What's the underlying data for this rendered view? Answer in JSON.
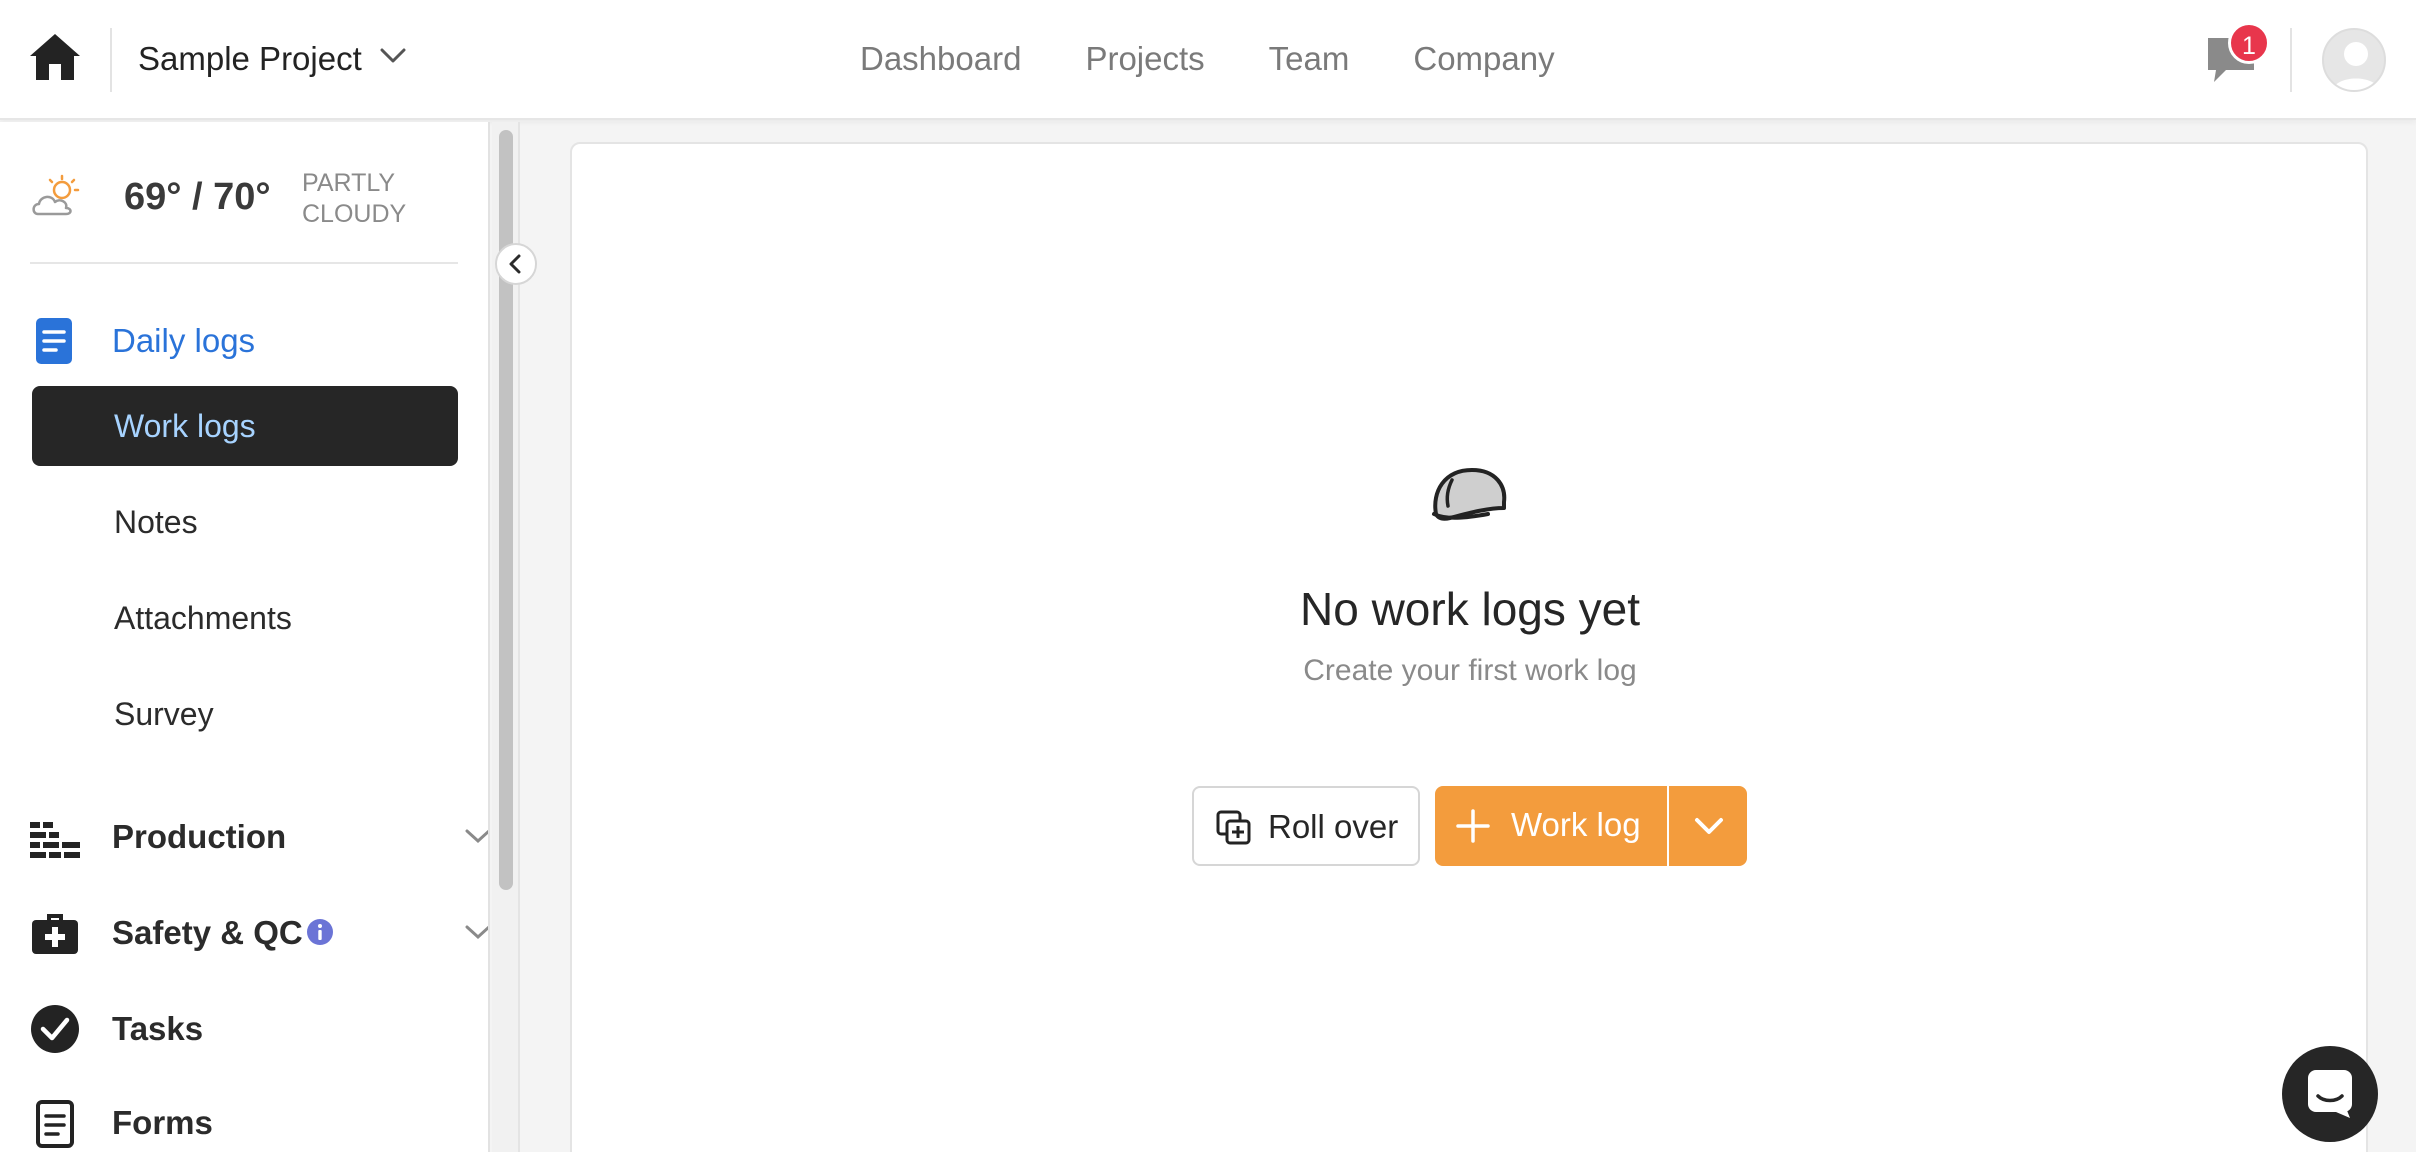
{
  "header": {
    "project_name": "Sample Project",
    "nav": [
      "Dashboard",
      "Projects",
      "Team",
      "Company"
    ],
    "notification_count": "1"
  },
  "sidebar": {
    "weather": {
      "temp": "69° / 70°",
      "desc": "PARTLY CLOUDY"
    },
    "daily_logs": {
      "label": "Daily logs",
      "items": [
        {
          "label": "Work logs",
          "active": true
        },
        {
          "label": "Notes"
        },
        {
          "label": "Attachments"
        },
        {
          "label": "Survey"
        }
      ]
    },
    "sections": [
      {
        "label": "Production",
        "icon": "bricks-icon",
        "expandable": true
      },
      {
        "label": "Safety & QC",
        "icon": "first-aid-kit-icon",
        "expandable": true,
        "info": true
      },
      {
        "label": "Tasks",
        "icon": "check-circle-icon"
      },
      {
        "label": "Forms",
        "icon": "clipboard-icon"
      }
    ]
  },
  "main": {
    "empty_title": "No work logs yet",
    "empty_subtitle": "Create your first work log",
    "rollover_label": "Roll over",
    "worklog_label": "Work log"
  },
  "colors": {
    "accent_orange": "#f39c3d",
    "active_blue": "#2a73d9",
    "badge_red": "#e8364c"
  }
}
